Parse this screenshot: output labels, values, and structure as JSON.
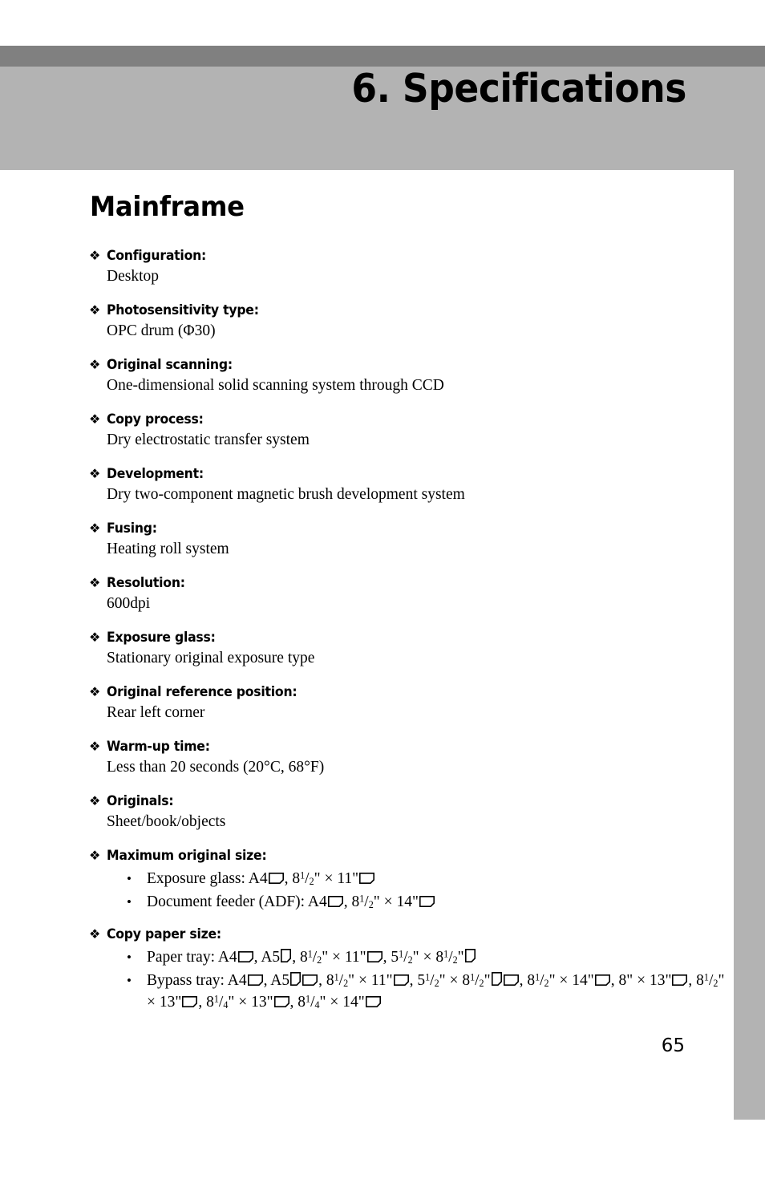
{
  "chapter": {
    "title": "6. Specifications"
  },
  "section": {
    "title": "Mainframe"
  },
  "bullet_glyph": "❖",
  "sub_bullet_glyph": "•",
  "specs": [
    {
      "term": "Configuration:",
      "desc": "Desktop"
    },
    {
      "term": "Photosensitivity type:",
      "desc": "OPC drum (Φ30)"
    },
    {
      "term": "Original scanning:",
      "desc": "One-dimensional solid scanning system through CCD"
    },
    {
      "term": "Copy process:",
      "desc": "Dry electrostatic transfer system"
    },
    {
      "term": "Development:",
      "desc": "Dry two-component magnetic brush development system"
    },
    {
      "term": "Fusing:",
      "desc": "Heating roll system"
    },
    {
      "term": "Resolution:",
      "desc": "600dpi"
    },
    {
      "term": "Exposure glass:",
      "desc": "Stationary original exposure type"
    },
    {
      "term": "Original reference position:",
      "desc": "Rear left corner"
    },
    {
      "term": "Warm-up time:",
      "desc": "Less than 20 seconds (20°C, 68°F)"
    },
    {
      "term": "Originals:",
      "desc": "Sheet/book/objects"
    },
    {
      "term": "Maximum original size:",
      "items": [
        "Exposure glass: A4⧉, 8¹/₂\" × 11\"⧉",
        "Document feeder (ADF): A4⧉, 8¹/₂\" × 14\"⧉"
      ]
    },
    {
      "term": "Copy paper size:",
      "items": [
        "Paper tray: A4⧉, A5⧈, 8¹/₂\" × 11\"⧉, 5¹/₂\" × 8¹/₂\"⧈",
        "Bypass tray: A4⧉, A5⧈⧉, 8¹/₂\" × 11\"⧉, 5¹/₂\" × 8¹/₂\"⧈⧉, 8¹/₂\" × 14\"⧉, 8\" × 13\"⧉, 8¹/₂\" × 13\"⧉, 8¹/₄\" × 13\"⧉, 8¹/₄\" × 14\"⧉"
      ]
    }
  ],
  "paper_sizes": {
    "max_original": [
      {
        "label": "Exposure glass: ",
        "parts": [
          {
            "text": "A4",
            "icon": "landscape"
          },
          {
            "text": ", ",
            "icon": null
          },
          {
            "frac_whole": "8",
            "frac_num": "1",
            "frac_den": "2",
            "text": "\" × 11\"",
            "icon": "landscape"
          }
        ]
      },
      {
        "label": "Document feeder (ADF): ",
        "parts": [
          {
            "text": "A4",
            "icon": "landscape"
          },
          {
            "text": ", ",
            "icon": null
          },
          {
            "frac_whole": "8",
            "frac_num": "1",
            "frac_den": "2",
            "text": "\" × 14\"",
            "icon": "landscape"
          }
        ]
      }
    ],
    "copy_paper": [
      {
        "label": "Paper tray: ",
        "parts": [
          {
            "text": "A4",
            "icon": "landscape"
          },
          {
            "text": ", ",
            "icon": null
          },
          {
            "text": "A5",
            "icon": "portrait"
          },
          {
            "text": ", ",
            "icon": null
          },
          {
            "frac_whole": "8",
            "frac_num": "1",
            "frac_den": "2",
            "text": "\" × 11\"",
            "icon": "landscape"
          },
          {
            "text": ", ",
            "icon": null
          },
          {
            "frac_whole": "5",
            "frac_num": "1",
            "frac_den": "2",
            "text": "\" × ",
            "icon": null
          },
          {
            "frac_whole": "8",
            "frac_num": "1",
            "frac_den": "2",
            "text": "\"",
            "icon": "portrait"
          }
        ]
      },
      {
        "label": "Bypass tray: ",
        "parts": [
          {
            "text": "A4",
            "icon": "landscape"
          },
          {
            "text": ", ",
            "icon": null
          },
          {
            "text": "A5",
            "icon": "portrait"
          },
          {
            "text": "",
            "icon": "landscape"
          },
          {
            "text": ", ",
            "icon": null
          },
          {
            "frac_whole": "8",
            "frac_num": "1",
            "frac_den": "2",
            "text": "\" × 11\"",
            "icon": "landscape"
          },
          {
            "text": ", ",
            "icon": null
          },
          {
            "frac_whole": "5",
            "frac_num": "1",
            "frac_den": "2",
            "text": "\" × ",
            "icon": null
          },
          {
            "frac_whole": "8",
            "frac_num": "1",
            "frac_den": "2",
            "text": "\"",
            "icon": "portrait"
          },
          {
            "text": "",
            "icon": "landscape"
          },
          {
            "text": ", ",
            "icon": null
          },
          {
            "frac_whole": "8",
            "frac_num": "1",
            "frac_den": "2",
            "text": "\" × 14\"",
            "icon": "landscape"
          },
          {
            "text": ", ",
            "icon": null
          },
          {
            "text": "8\" × 13\"",
            "icon": "landscape"
          },
          {
            "text": ", ",
            "icon": null
          },
          {
            "frac_whole": "8",
            "frac_num": "1",
            "frac_den": "2",
            "text": "\" × 13\"",
            "icon": "landscape"
          },
          {
            "text": ", ",
            "icon": null
          },
          {
            "frac_whole": "8",
            "frac_num": "1",
            "frac_den": "4",
            "text": "\" × 13\"",
            "icon": "landscape"
          },
          {
            "text": ", ",
            "icon": null
          },
          {
            "frac_whole": "8",
            "frac_num": "1",
            "frac_den": "4",
            "text": "\" × 14\"",
            "icon": "landscape"
          }
        ]
      }
    ]
  },
  "footer": {
    "page_number": "65"
  },
  "colors": {
    "header_band": "#b3b3b3",
    "header_rule": "#808080",
    "page_background": "#ffffff",
    "text": "#000000"
  }
}
